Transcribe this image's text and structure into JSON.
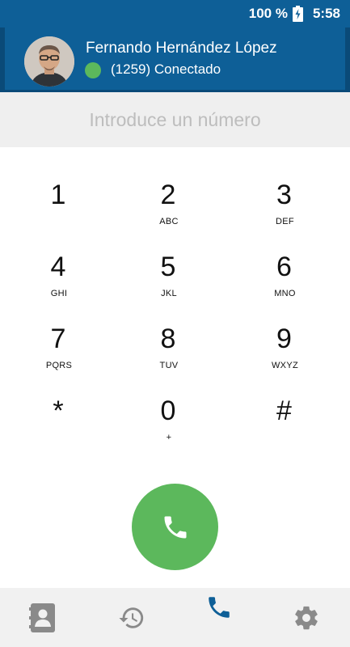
{
  "status_bar": {
    "battery": "100 %",
    "time": "5:58"
  },
  "user": {
    "name": "Fernando Hernández López",
    "status": "(1259) Conectado",
    "status_color": "#5cb85c"
  },
  "dialer": {
    "placeholder": "Introduce un número",
    "keys": [
      {
        "digit": "1",
        "letters": ""
      },
      {
        "digit": "2",
        "letters": "ABC"
      },
      {
        "digit": "3",
        "letters": "DEF"
      },
      {
        "digit": "4",
        "letters": "GHI"
      },
      {
        "digit": "5",
        "letters": "JKL"
      },
      {
        "digit": "6",
        "letters": "MNO"
      },
      {
        "digit": "7",
        "letters": "PQRS"
      },
      {
        "digit": "8",
        "letters": "TUV"
      },
      {
        "digit": "9",
        "letters": "WXYZ"
      },
      {
        "digit": "*",
        "letters": ""
      },
      {
        "digit": "0",
        "letters": "+"
      },
      {
        "digit": "#",
        "letters": ""
      }
    ],
    "call_icon": "phone-icon",
    "call_color": "#5cb85c"
  },
  "nav": {
    "items": [
      {
        "icon": "contacts-icon",
        "active": false
      },
      {
        "icon": "history-icon",
        "active": false
      },
      {
        "icon": "phone-icon",
        "active": true
      },
      {
        "icon": "gear-icon",
        "active": false
      }
    ],
    "active_color": "#0e5f97",
    "inactive_color": "#8a8a8a"
  },
  "colors": {
    "primary": "#0e5f97"
  }
}
